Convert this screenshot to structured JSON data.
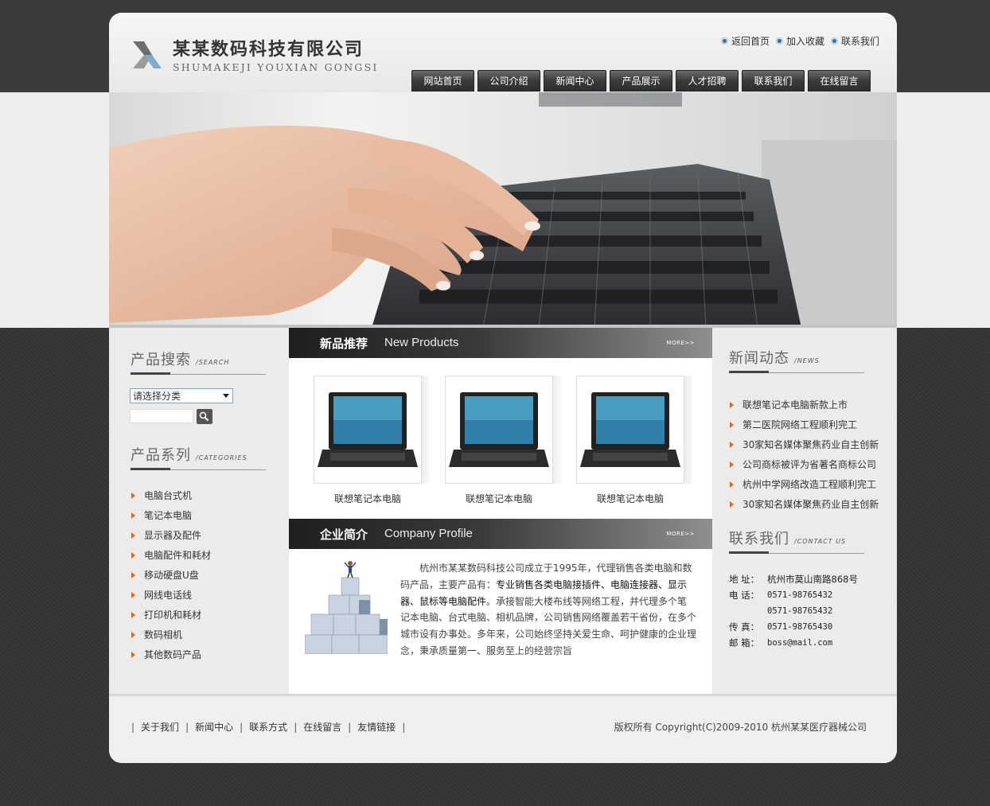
{
  "header": {
    "logo_cn": "某某数码科技有限公司",
    "logo_en": "SHUMAKEJI YOUXIAN GONGSI",
    "top_links": [
      "返回首页",
      "加入收藏",
      "联系我们"
    ]
  },
  "nav": [
    "网站首页",
    "公司介绍",
    "新闻中心",
    "产品展示",
    "人才招聘",
    "联系我们",
    "在线留言"
  ],
  "search": {
    "title": "产品搜索",
    "title_en": "/SEARCH",
    "select_value": "请选择分类"
  },
  "categories": {
    "title": "产品系列",
    "title_en": "/CATEGORIES",
    "items": [
      "电脑台式机",
      "笔记本电脑",
      "显示器及配件",
      "电脑配件和耗材",
      "移动硬盘U盘",
      "网线电话线",
      "打印机和耗材",
      "数码相机",
      "其他数码产品"
    ]
  },
  "new_products": {
    "title_cn": "新品推荐",
    "title_en": "New Products",
    "more": "MORE>>",
    "items": [
      {
        "name": "联想笔记本电脑"
      },
      {
        "name": "联想笔记本电脑"
      },
      {
        "name": "联想笔记本电脑"
      }
    ]
  },
  "profile": {
    "title_cn": "企业简介",
    "title_en": "Company Profile",
    "more": "MORE>>",
    "text_1": "杭州市某某数码科技公司成立于1995年，代理销售各类电脑和数码产品，主要产品有：",
    "text_bold": "专业销售各类电脑接插件、电脑连接器、显示器、鼠标等电脑配件",
    "text_2": "。承接智能大楼布线等网络工程，并代理多个笔记本电脑、台式电脑、相机品牌，公司销售网络覆盖若干省份，在多个城市设有办事处。多年来，公司始终坚持关爱生命、呵护健康的企业理念，秉承质量第一、服务至上的经营宗旨"
  },
  "news": {
    "title": "新闻动态",
    "title_en": "/NEWS",
    "items": [
      "联想笔记本电脑新款上市",
      "第二医院网络工程顺利完工",
      "30家知名媒体聚焦药业自主创新",
      "公司商标被评为省著名商标公司",
      "杭州中学网络改造工程顺利完工",
      "30家知名媒体聚焦药业自主创新"
    ]
  },
  "contact": {
    "title": "联系我们",
    "title_en": "/CONTACT US",
    "address_label": "地  址：",
    "address": "杭州市莫山南路868号",
    "phone_label": "电  话：",
    "phone_1": "0571-98765432",
    "phone_2": "0571-98765432",
    "fax_label": "传  真：",
    "fax": "0571-98765430",
    "email_label": "邮  箱：",
    "email": "boss@mail.com"
  },
  "footer": {
    "links": [
      "关于我们",
      "新闻中心",
      "联系方式",
      "在线留言",
      "友情链接"
    ],
    "copyright": "版权所有 Copyright(C)2009-2010 杭州某某医疗器械公司"
  },
  "colors": {
    "accent": "#e5650e",
    "dark_bg": "#3b3a39",
    "nav_bg": "#3b3b3b"
  }
}
